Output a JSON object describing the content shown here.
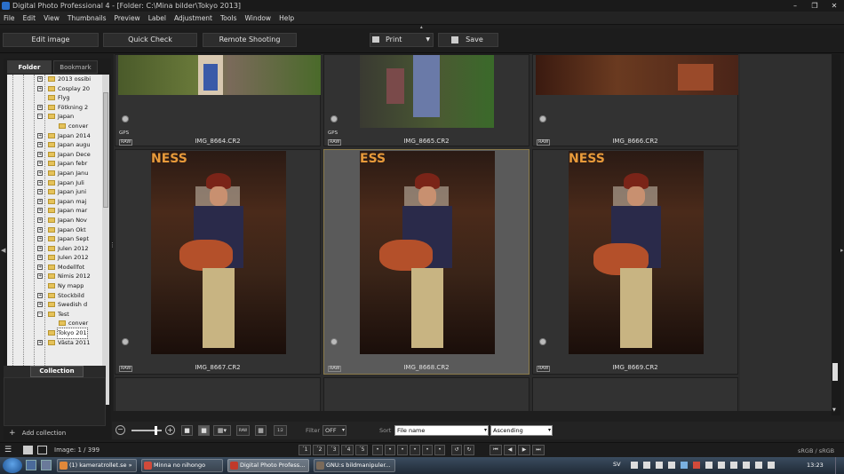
{
  "window": {
    "title": "Digital Photo Professional 4 - [Folder: C:\\Mina bilder\\Tokyo 2013]",
    "controls": {
      "minimize": "–",
      "restore": "❐",
      "close": "✕"
    }
  },
  "menu": [
    "File",
    "Edit",
    "View",
    "Thumbnails",
    "Preview",
    "Label",
    "Adjustment",
    "Tools",
    "Window",
    "Help"
  ],
  "toolbar": {
    "edit_image": "Edit image",
    "quick_check": "Quick Check",
    "remote_shooting": "Remote Shooting",
    "print": "Print",
    "save": "Save"
  },
  "left_panel": {
    "tabs": {
      "folder": "Folder",
      "bookmark": "Bookmark"
    },
    "tree": [
      {
        "label": "2013 ossibi",
        "expander": "+"
      },
      {
        "label": "Cosplay 20",
        "expander": "+"
      },
      {
        "label": "Flyg",
        "expander": ""
      },
      {
        "label": "Fötkning 2",
        "expander": "+"
      },
      {
        "label": "Japan",
        "expander": "−"
      },
      {
        "label": "conver",
        "expander": ""
      },
      {
        "label": "Japan 2014",
        "expander": "+"
      },
      {
        "label": "Japan augu",
        "expander": "+"
      },
      {
        "label": "Japan Dece",
        "expander": "+"
      },
      {
        "label": "Japan febr",
        "expander": "+"
      },
      {
        "label": "Japan Janu",
        "expander": "+"
      },
      {
        "label": "Japan Juli",
        "expander": "+"
      },
      {
        "label": "Japan juni",
        "expander": "+"
      },
      {
        "label": "Japan maj",
        "expander": "+"
      },
      {
        "label": "Japan mar",
        "expander": "+"
      },
      {
        "label": "Japan Nov",
        "expander": "+"
      },
      {
        "label": "Japan Okt",
        "expander": "+"
      },
      {
        "label": "Japan Sept",
        "expander": "+"
      },
      {
        "label": "Julen 2012",
        "expander": "+"
      },
      {
        "label": "Julen 2012",
        "expander": "+"
      },
      {
        "label": "Modellfot",
        "expander": "+"
      },
      {
        "label": "Nimis 2012",
        "expander": "+"
      },
      {
        "label": "Ny mapp",
        "expander": ""
      },
      {
        "label": "Stockbild",
        "expander": "+"
      },
      {
        "label": "Swedish d",
        "expander": "+"
      },
      {
        "label": "Test",
        "expander": "−"
      },
      {
        "label": "conver",
        "expander": ""
      },
      {
        "label": "Tokyo 201",
        "expander": "",
        "selected": true
      },
      {
        "label": "Västa 2011",
        "expander": "+"
      }
    ],
    "collection_tab": "Collection",
    "add_collection": "Add collection"
  },
  "thumbnails": [
    {
      "name": "IMG_8664.CR2",
      "gps": "GPS",
      "raw": "RAW"
    },
    {
      "name": "IMG_8665.CR2",
      "gps": "GPS",
      "raw": "RAW"
    },
    {
      "name": "IMG_8666.CR2",
      "gps": "",
      "raw": "RAW"
    },
    {
      "name": "IMG_8667.CR2",
      "gps": "",
      "raw": "RAW",
      "sign": "NESS"
    },
    {
      "name": "IMG_8668.CR2",
      "gps": "",
      "raw": "RAW",
      "selected": true,
      "sign": "ESS"
    },
    {
      "name": "IMG_8669.CR2",
      "gps": "",
      "raw": "RAW",
      "sign": "NESS"
    }
  ],
  "bottom": {
    "filter_label": "Filter",
    "filter_value": "OFF",
    "sort_label": "Sort",
    "sort_field": "File name",
    "sort_order": "Ascending"
  },
  "status": {
    "image_count": "Image: 1 / 399",
    "color_space": "sRGB / sRGB",
    "ratings": [
      "´1",
      "´2",
      "´3",
      "´4",
      "´5"
    ]
  },
  "taskbar": {
    "tasks": [
      {
        "label": "(1) kameratrollet.se »",
        "color": "#e0883a"
      },
      {
        "label": "Minna no nihongo",
        "color": "#d14a3a"
      },
      {
        "label": "Digital Photo Profess...",
        "color": "#c13a2a"
      },
      {
        "label": "GNU:s bildmanipuler...",
        "color": "#7a6a5a"
      }
    ],
    "lang": "SV",
    "clock": "13:23"
  }
}
